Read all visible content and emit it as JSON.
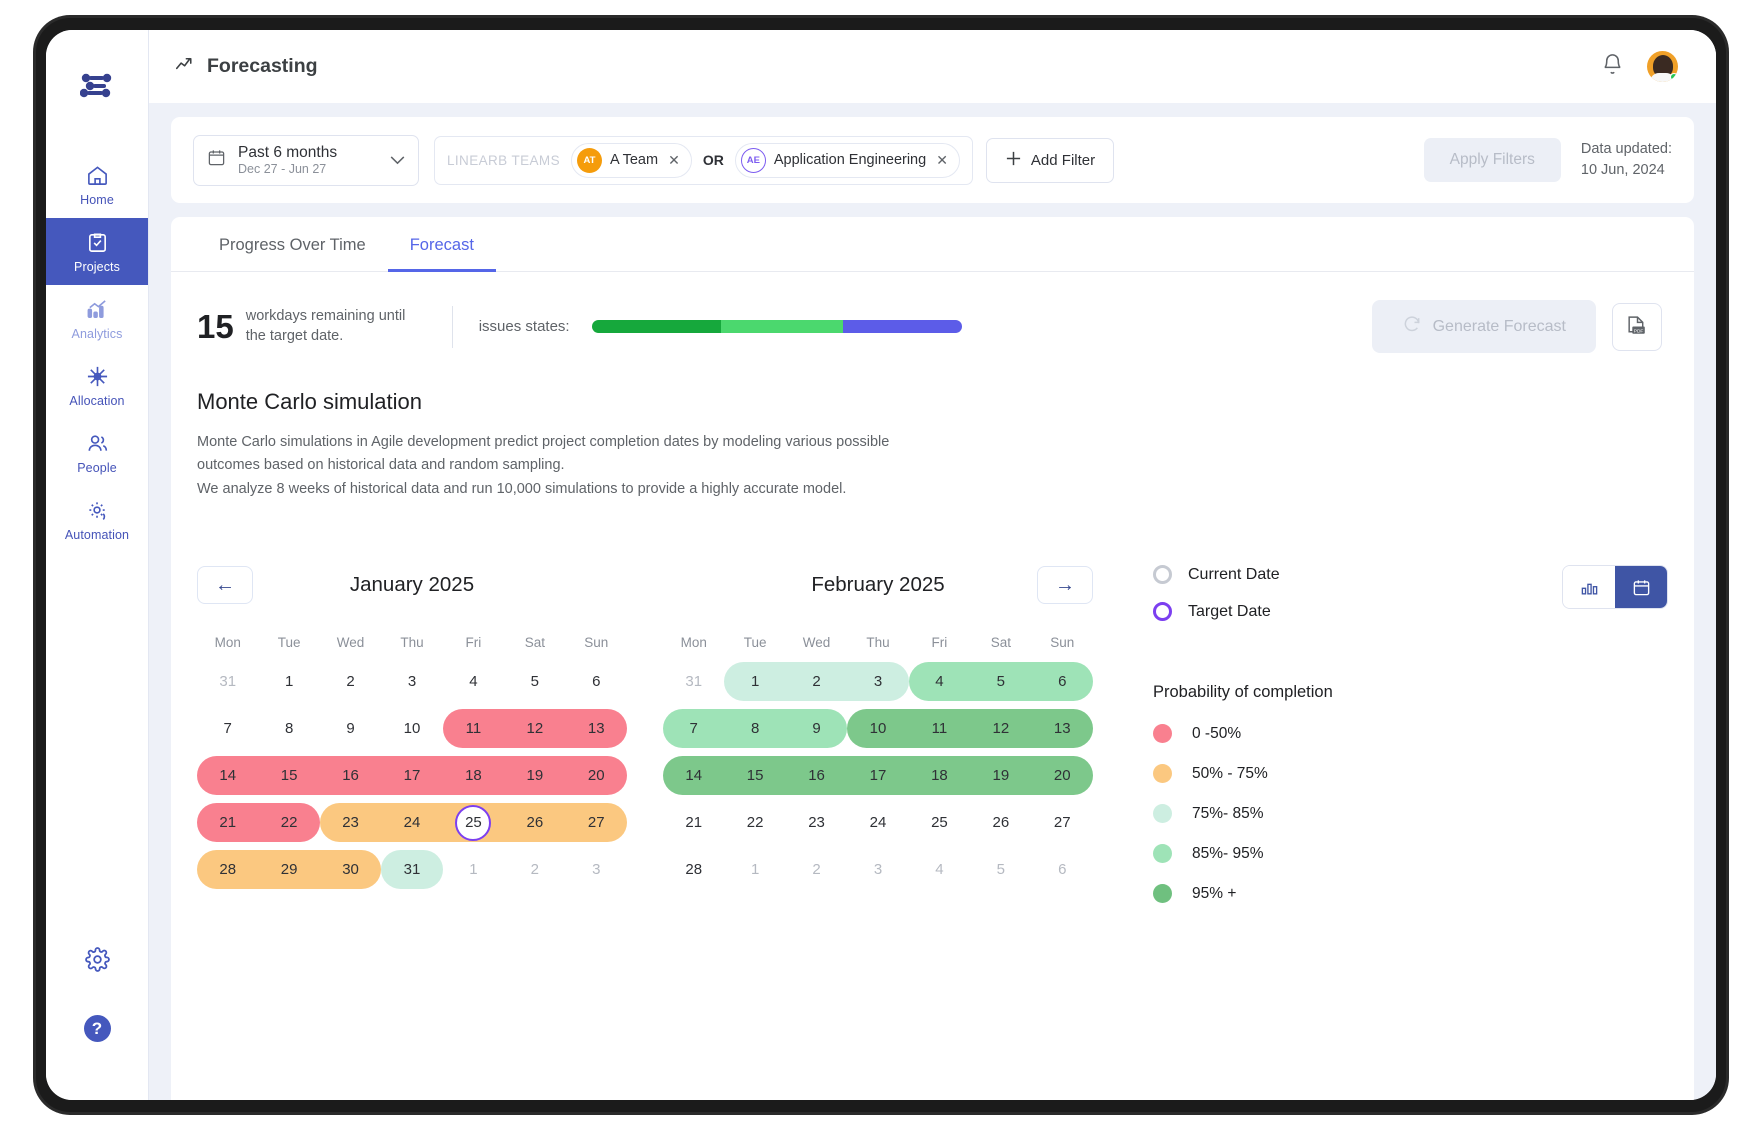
{
  "sidebar": {
    "logo_icon": "linearb-logo-icon",
    "items": [
      {
        "label": "Home",
        "icon": "home-icon",
        "active": false,
        "muted": false
      },
      {
        "label": "Projects",
        "icon": "clipboard-check-icon",
        "active": true,
        "muted": false
      },
      {
        "label": "Analytics",
        "icon": "bar-chart-icon",
        "active": false,
        "muted": true
      },
      {
        "label": "Allocation",
        "icon": "allocation-icon",
        "active": false,
        "muted": false
      },
      {
        "label": "People",
        "icon": "people-icon",
        "active": false,
        "muted": false
      },
      {
        "label": "Automation",
        "icon": "gear-refresh-icon",
        "active": false,
        "muted": false
      }
    ],
    "settings_icon": "gear-icon",
    "help_label": "?"
  },
  "topbar": {
    "title": "Forecasting",
    "title_icon": "trending-up-icon",
    "notifications_icon": "bell-icon",
    "avatar_icon": "user-avatar"
  },
  "filters": {
    "date_range": {
      "label": "Past 6 months",
      "sub": "Dec 27 - Jun 27",
      "icon": "calendar-icon",
      "chevron": "chevron-down-icon"
    },
    "teams_label": "LINEARB TEAMS",
    "chips": [
      {
        "initials": "AT",
        "name": "A Team",
        "style": "orange"
      },
      {
        "initials": "AE",
        "name": "Application Engineering",
        "style": "outline"
      }
    ],
    "operator": "OR",
    "add_filter": "Add Filter",
    "apply_filters": "Apply Filters",
    "data_updated_label": "Data updated:",
    "data_updated_value": "10 Jun, 2024"
  },
  "tabs": [
    {
      "label": "Progress Over Time",
      "active": false
    },
    {
      "label": "Forecast",
      "active": true
    }
  ],
  "summary": {
    "workdays_number": "15",
    "workdays_text": "workdays remaining until the target date.",
    "issues_label": "issues states:",
    "issue_segments": [
      {
        "color": "#16a83c",
        "pct": 35
      },
      {
        "color": "#4bd86e",
        "pct": 33
      },
      {
        "color": "#5c5ce8",
        "pct": 32
      }
    ],
    "generate_forecast": "Generate Forecast",
    "generate_icon": "refresh-icon",
    "pdf_icon": "pdf-export-icon"
  },
  "monte_carlo": {
    "title": "Monte Carlo simulation",
    "desc_line1": "Monte Carlo simulations in Agile development predict project completion dates by modeling various possible",
    "desc_line2": "outcomes based on historical data and random sampling.",
    "desc_line3": "We analyze 8 weeks of historical data and run 10,000 simulations to provide a highly accurate model."
  },
  "calendars": {
    "prev_icon": "arrow-left-icon",
    "next_icon": "arrow-right-icon",
    "dow": [
      "Mon",
      "Tue",
      "Wed",
      "Thu",
      "Fri",
      "Sat",
      "Sun"
    ],
    "january": {
      "title": "January 2025",
      "weeks": [
        [
          {
            "d": "31",
            "o": true
          },
          {
            "d": "1"
          },
          {
            "d": "2"
          },
          {
            "d": "3"
          },
          {
            "d": "4"
          },
          {
            "d": "5"
          },
          {
            "d": "6"
          }
        ],
        [
          {
            "d": "7"
          },
          {
            "d": "8"
          },
          {
            "d": "9"
          },
          {
            "d": "10"
          },
          {
            "d": "11"
          },
          {
            "d": "12"
          },
          {
            "d": "13"
          }
        ],
        [
          {
            "d": "14"
          },
          {
            "d": "15"
          },
          {
            "d": "16"
          },
          {
            "d": "17"
          },
          {
            "d": "18"
          },
          {
            "d": "19"
          },
          {
            "d": "20"
          }
        ],
        [
          {
            "d": "21"
          },
          {
            "d": "22"
          },
          {
            "d": "23"
          },
          {
            "d": "24"
          },
          {
            "d": "25",
            "target": true
          },
          {
            "d": "26"
          },
          {
            "d": "27"
          }
        ],
        [
          {
            "d": "28"
          },
          {
            "d": "29"
          },
          {
            "d": "30"
          },
          {
            "d": "31"
          },
          {
            "d": "1",
            "o": true
          },
          {
            "d": "2",
            "o": true
          },
          {
            "d": "3",
            "o": true
          }
        ]
      ],
      "segments": [
        {
          "row": 1,
          "start": 4,
          "end": 6,
          "color": "#f9808f"
        },
        {
          "row": 2,
          "start": 0,
          "end": 6,
          "color": "#f9808f"
        },
        {
          "row": 3,
          "start": 0,
          "end": 1,
          "color": "#f9808f"
        },
        {
          "row": 3,
          "start": 2,
          "end": 6,
          "color": "#fbc880"
        },
        {
          "row": 4,
          "start": 0,
          "end": 2,
          "color": "#fbc880"
        },
        {
          "row": 4,
          "start": 3,
          "end": 3,
          "color": "#cdeee1"
        }
      ]
    },
    "february": {
      "title": "February 2025",
      "weeks": [
        [
          {
            "d": "31",
            "o": true
          },
          {
            "d": "1"
          },
          {
            "d": "2"
          },
          {
            "d": "3"
          },
          {
            "d": "4"
          },
          {
            "d": "5"
          },
          {
            "d": "6"
          }
        ],
        [
          {
            "d": "7"
          },
          {
            "d": "8"
          },
          {
            "d": "9"
          },
          {
            "d": "10"
          },
          {
            "d": "11"
          },
          {
            "d": "12"
          },
          {
            "d": "13"
          }
        ],
        [
          {
            "d": "14"
          },
          {
            "d": "15"
          },
          {
            "d": "16"
          },
          {
            "d": "17"
          },
          {
            "d": "18"
          },
          {
            "d": "19"
          },
          {
            "d": "20"
          }
        ],
        [
          {
            "d": "21"
          },
          {
            "d": "22"
          },
          {
            "d": "23"
          },
          {
            "d": "24"
          },
          {
            "d": "25"
          },
          {
            "d": "26"
          },
          {
            "d": "27"
          }
        ],
        [
          {
            "d": "28"
          },
          {
            "d": "1",
            "o": true
          },
          {
            "d": "2",
            "o": true
          },
          {
            "d": "3",
            "o": true
          },
          {
            "d": "4",
            "o": true
          },
          {
            "d": "5",
            "o": true
          },
          {
            "d": "6",
            "o": true
          }
        ]
      ],
      "segments": [
        {
          "row": 0,
          "start": 1,
          "end": 3,
          "color": "#cdeee1"
        },
        {
          "row": 0,
          "start": 4,
          "end": 6,
          "color": "#9ee3b7"
        },
        {
          "row": 1,
          "start": 0,
          "end": 2,
          "color": "#9ee3b7"
        },
        {
          "row": 1,
          "start": 3,
          "end": 6,
          "color": "#7dc88b"
        },
        {
          "row": 2,
          "start": 0,
          "end": 6,
          "color": "#7dc88b"
        }
      ]
    }
  },
  "legend": {
    "date_items": [
      {
        "label": "Current Date",
        "type": "current"
      },
      {
        "label": "Target Date",
        "type": "target"
      }
    ],
    "view_toggle": [
      {
        "icon": "bar-chart-view-icon",
        "active": false
      },
      {
        "icon": "calendar-view-icon",
        "active": true
      }
    ],
    "prob_title": "Probability of completion",
    "prob_items": [
      {
        "label": "0 -50%",
        "color": "#f9808f"
      },
      {
        "label": "50% - 75%",
        "color": "#fbc880"
      },
      {
        "label": "75%- 85%",
        "color": "#cdeee1"
      },
      {
        "label": "85%- 95%",
        "color": "#9ee3b7"
      },
      {
        "label": "95% +",
        "color": "#6fc07f"
      }
    ]
  }
}
